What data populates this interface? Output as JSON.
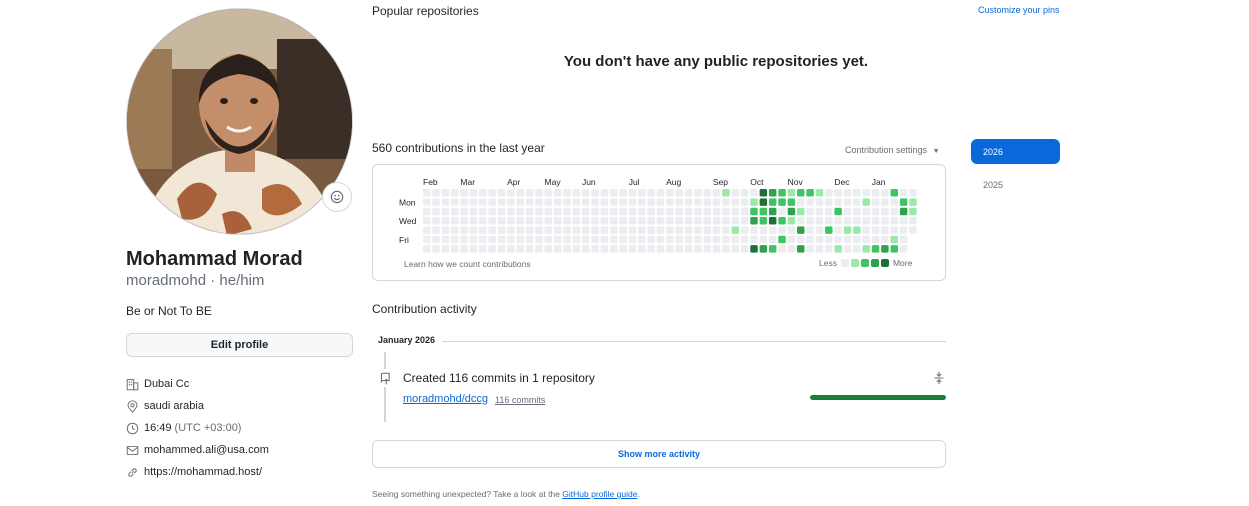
{
  "profile": {
    "name": "Mohammad Morad",
    "login": "moradmohd",
    "pronouns": "he/him",
    "bio": "Be or Not To BE",
    "edit_label": "Edit profile",
    "details": [
      {
        "icon": "organization-icon",
        "text": "Dubai Cc"
      },
      {
        "icon": "location-icon",
        "text": "saudi arabia"
      },
      {
        "icon": "clock-icon",
        "text": "16:49",
        "extra": "(UTC +03:00)"
      },
      {
        "icon": "mail-icon",
        "text": "mohammed.ali@usa.com"
      },
      {
        "icon": "link-icon",
        "text": "https://mohammad.host/"
      }
    ]
  },
  "popular": {
    "title": "Popular repositories",
    "customize_label": "Customize your pins",
    "empty_message": "You don't have any public repositories yet."
  },
  "contributions": {
    "title": "560 contributions in the last year",
    "settings_label": "Contribution settings",
    "months": [
      "Feb",
      "Mar",
      "Apr",
      "May",
      "Jun",
      "Jul",
      "Aug",
      "Sep",
      "Oct",
      "Nov",
      "Dec",
      "Jan"
    ],
    "day_labels": [
      "Mon",
      "Wed",
      "Fri"
    ],
    "learn_label": "Learn how we count contributions",
    "legend_less": "Less",
    "legend_more": "More",
    "colors": [
      "#ebedf0",
      "#9be9a8",
      "#40c463",
      "#30a14e",
      "#216e39"
    ],
    "active_weeks": [
      [
        0,
        0,
        0,
        0,
        0,
        0,
        0
      ],
      [
        0,
        0,
        0,
        0,
        0,
        0,
        0
      ],
      [
        0,
        0,
        0,
        0,
        0,
        0,
        0
      ],
      [
        0,
        0,
        0,
        0,
        0,
        0,
        0
      ],
      [
        1,
        0,
        0,
        0,
        0,
        0,
        0
      ],
      [
        0,
        0,
        0,
        0,
        1,
        0,
        0
      ],
      [
        0,
        0,
        0,
        0,
        0,
        0,
        0
      ],
      [
        0,
        1,
        2,
        3,
        0,
        0,
        4
      ],
      [
        4,
        4,
        2,
        2,
        0,
        0,
        3
      ],
      [
        3,
        2,
        3,
        4,
        0,
        0,
        2
      ],
      [
        2,
        2,
        0,
        2,
        0,
        2,
        0
      ],
      [
        1,
        2,
        3,
        1,
        0,
        0,
        0
      ],
      [
        2,
        0,
        1,
        0,
        3,
        0,
        3
      ],
      [
        2,
        0,
        0,
        0,
        0,
        0,
        0
      ],
      [
        1,
        0,
        0,
        0,
        0,
        0,
        0
      ],
      [
        0,
        0,
        0,
        0,
        2,
        0,
        0
      ],
      [
        0,
        0,
        2,
        0,
        0,
        0,
        1
      ],
      [
        0,
        0,
        0,
        0,
        1,
        0,
        0
      ],
      [
        0,
        0,
        0,
        0,
        1,
        0,
        0
      ],
      [
        0,
        1,
        0,
        0,
        0,
        0,
        1
      ],
      [
        0,
        0,
        0,
        0,
        0,
        0,
        2
      ],
      [
        0,
        0,
        0,
        0,
        0,
        0,
        3
      ],
      [
        2,
        0,
        0,
        0,
        0,
        1,
        2
      ],
      [
        0,
        2,
        3,
        0,
        0,
        0,
        0
      ],
      [
        0,
        1,
        1,
        0,
        0,
        0,
        0
      ]
    ]
  },
  "years": [
    {
      "label": "2026",
      "active": true
    },
    {
      "label": "2025",
      "active": false
    }
  ],
  "activity": {
    "title": "Contribution activity",
    "month": "January 2026",
    "commit_summary": "Created 116 commits in 1 repository",
    "repo_name": "moradmohd/dccg",
    "repo_commits": "116 commits",
    "repo_share": 1.0,
    "show_more_label": "Show more activity"
  },
  "footer": {
    "text": "Seeing something unexpected? Take a look at the",
    "link": "GitHub profile guide",
    "suffix": "."
  }
}
